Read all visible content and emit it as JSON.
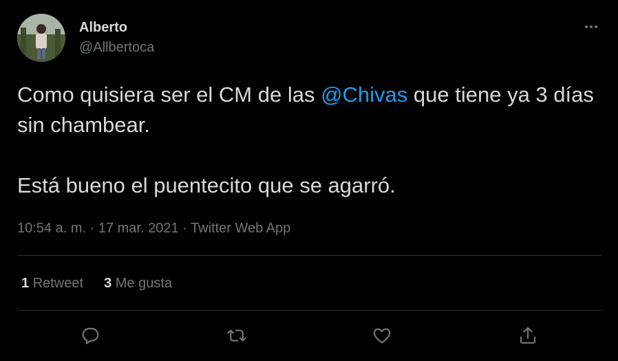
{
  "author": {
    "name": "Alberto",
    "handle": "@Allbertoca"
  },
  "tweet": {
    "line1_before": "Como quisiera ser el CM de las ",
    "mention": "@Chivas",
    "line1_after": " que tiene ya 3 días sin chambear.",
    "line2": "Está bueno el puentecito que se agarró."
  },
  "meta": {
    "time": "10:54 a. m.",
    "sep1": " · ",
    "date": "17 mar. 2021",
    "sep2": " · ",
    "source": "Twitter Web App"
  },
  "stats": {
    "retweets_count": "1",
    "retweets_label": "Retweet",
    "likes_count": "3",
    "likes_label": "Me gusta"
  },
  "icons": {
    "reply": "reply-icon",
    "retweet": "retweet-icon",
    "like": "heart-icon",
    "share": "share-icon",
    "more": "more-icon"
  },
  "colors": {
    "background": "#000000",
    "text": "#d9d9d9",
    "secondary": "#6e767d",
    "link": "#1d9bf0",
    "divider": "#2f3336"
  }
}
